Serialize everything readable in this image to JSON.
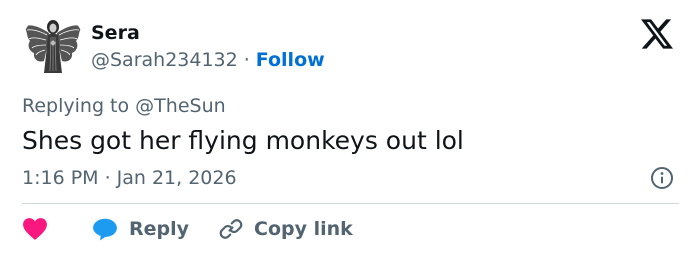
{
  "user": {
    "name": "Sera",
    "handle": "@Sarah234132",
    "separator": "·",
    "follow_label": "Follow",
    "avatar_icon": "angel-avatar-icon"
  },
  "brand": {
    "logo_icon": "x-logo-icon"
  },
  "tweet": {
    "replying_prefix": "Replying to",
    "replying_to": "@TheSun",
    "text": "Shes got her flying monkeys out lol",
    "time": "1:16 PM",
    "meta_separator": "·",
    "date": "Jan 21, 2026"
  },
  "actions": {
    "like_icon": "heart-icon",
    "reply_icon": "speech-bubble-icon",
    "reply_label": "Reply",
    "copy_icon": "link-icon",
    "copy_label": "Copy link",
    "info_icon": "info-icon"
  },
  "colors": {
    "text": "#0f1419",
    "secondary": "#536471",
    "follow": "#006fd6",
    "heart": "#f91880",
    "reply_bubble": "#1d9bf0",
    "divider": "#cfd9de"
  }
}
